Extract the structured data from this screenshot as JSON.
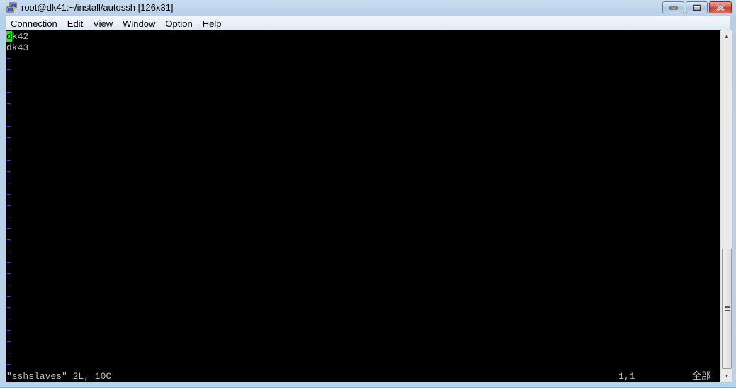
{
  "window": {
    "title": "root@dk41:~/install/autossh [126x31]",
    "app_icon": "putty-icon",
    "buttons": {
      "minimize": "minimize",
      "maximize": "maximize",
      "close": "close"
    }
  },
  "menubar": {
    "items": [
      {
        "label": "Connection"
      },
      {
        "label": "Edit"
      },
      {
        "label": "View"
      },
      {
        "label": "Window"
      },
      {
        "label": "Option"
      },
      {
        "label": "Help"
      }
    ]
  },
  "terminal": {
    "cursor_char": "d",
    "lines": [
      {
        "text": "k42",
        "prefix_cursor": true
      },
      {
        "text": "dk43"
      }
    ],
    "tilde_count": 28,
    "tilde_char": "~",
    "status": {
      "file_info": "\"sshslaves\" 2L, 10C",
      "position": "1,1",
      "percent": "全部"
    },
    "colors": {
      "background": "#000000",
      "text": "#c0c0c0",
      "tilde": "#4f4fff",
      "cursor": "#00ff00"
    }
  },
  "scrollbar": {
    "up_arrow": "▲",
    "down_arrow": "▼"
  }
}
